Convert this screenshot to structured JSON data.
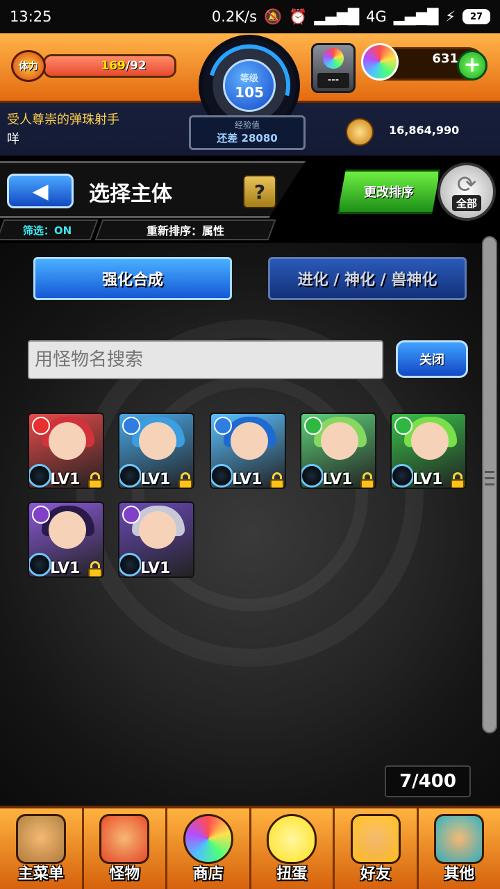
{
  "status_bar": {
    "time": "13:25",
    "net_speed": "0.2K/s",
    "network": "4G",
    "battery": "27"
  },
  "header": {
    "stamina_label": "体力",
    "stamina_current": "169",
    "stamina_max": "/92",
    "stamina_fill": 1.0,
    "level_label": "等级",
    "level_value": "105",
    "exp_label": "经验值",
    "exp_remaining": "还差 28080",
    "lantern_text": "---",
    "orb_count": "631",
    "plus_symbol": "+",
    "player_title": "受人尊崇的弹珠射手",
    "player_name": "咩",
    "coins": "16,864,990"
  },
  "titlebar": {
    "back_symbol": "◀",
    "title": "选择主体",
    "help_symbol": "?",
    "filter_label": "筛选：ON",
    "sort_label": "重新排序：属性",
    "change_sort": "更改排序",
    "all_label": "全部",
    "refresh_symbol": "⟳"
  },
  "tabs": {
    "active": "强化合成",
    "inactive": "进化 / 神化 / 兽神化"
  },
  "search": {
    "placeholder": "用怪物名搜索",
    "close_label": "关闭"
  },
  "monsters": [
    {
      "level": "LV1",
      "element": "fire",
      "locked": true,
      "bg": "#e84a4a",
      "hair": "#d2323a",
      "elem_color": "#e83030"
    },
    {
      "level": "LV1",
      "element": "water",
      "locked": true,
      "bg": "#4aa8e8",
      "hair": "#3a9ee0",
      "elem_color": "#2f7de0"
    },
    {
      "level": "LV1",
      "element": "water",
      "locked": true,
      "bg": "#5ac0ff",
      "hair": "#1f6ad0",
      "elem_color": "#2f7de0"
    },
    {
      "level": "LV1",
      "element": "wood",
      "locked": true,
      "bg": "#5ed07a",
      "hair": "#86d860",
      "elem_color": "#2fb83f"
    },
    {
      "level": "LV1",
      "element": "wood",
      "locked": true,
      "bg": "#39c04a",
      "hair": "#7ae04a",
      "elem_color": "#2fb83f"
    },
    {
      "level": "LV1",
      "element": "dark",
      "locked": true,
      "bg": "#8a5ad8",
      "hair": "#2a1a4a",
      "elem_color": "#8040c8"
    },
    {
      "level": "LV1",
      "element": "dark",
      "locked": false,
      "bg": "#6a4ab8",
      "hair": "#c8c8d8",
      "elem_color": "#8040c8"
    }
  ],
  "box_count": "7/400",
  "bottom_nav": [
    {
      "label": "主菜单",
      "icon": "castle-icon",
      "color": "#b08040"
    },
    {
      "label": "怪物",
      "icon": "monster-icon",
      "color": "#e84a2a"
    },
    {
      "label": "商店",
      "icon": "orb-icon",
      "color": "#ffffff"
    },
    {
      "label": "扭蛋",
      "icon": "egg-icon",
      "color": "#ffe020"
    },
    {
      "label": "好友",
      "icon": "friends-icon",
      "color": "#ffc020"
    },
    {
      "label": "其他",
      "icon": "other-icon",
      "color": "#30b0c0"
    }
  ]
}
